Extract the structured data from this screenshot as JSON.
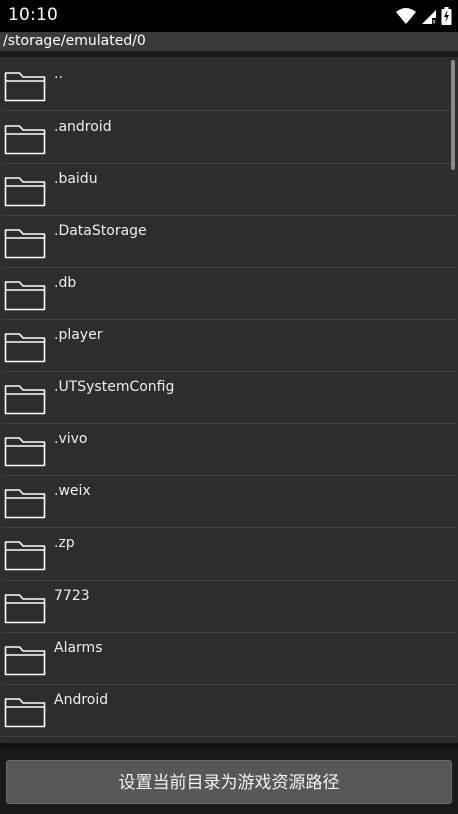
{
  "status_bar": {
    "time": "10:10",
    "icons": [
      "wifi-icon",
      "signal-icon",
      "battery-charging-icon"
    ]
  },
  "path": "/storage/emulated/0",
  "files": [
    {
      "name": "..",
      "icon": "folder-icon"
    },
    {
      "name": ".android",
      "icon": "folder-icon"
    },
    {
      "name": ".baidu",
      "icon": "folder-icon"
    },
    {
      "name": ".DataStorage",
      "icon": "folder-icon"
    },
    {
      "name": ".db",
      "icon": "folder-icon"
    },
    {
      "name": ".player",
      "icon": "folder-icon"
    },
    {
      "name": ".UTSystemConfig",
      "icon": "folder-icon"
    },
    {
      "name": ".vivo",
      "icon": "folder-icon"
    },
    {
      "name": ".weix",
      "icon": "folder-icon"
    },
    {
      "name": ".zp",
      "icon": "folder-icon"
    },
    {
      "name": "7723",
      "icon": "folder-icon"
    },
    {
      "name": "Alarms",
      "icon": "folder-icon"
    },
    {
      "name": "Android",
      "icon": "folder-icon"
    }
  ],
  "action_button": {
    "label": "设置当前目录为游戏资源路径"
  },
  "colors": {
    "list_background": "#2d2d2d",
    "divider": "#414141",
    "button_background": "#575757"
  }
}
